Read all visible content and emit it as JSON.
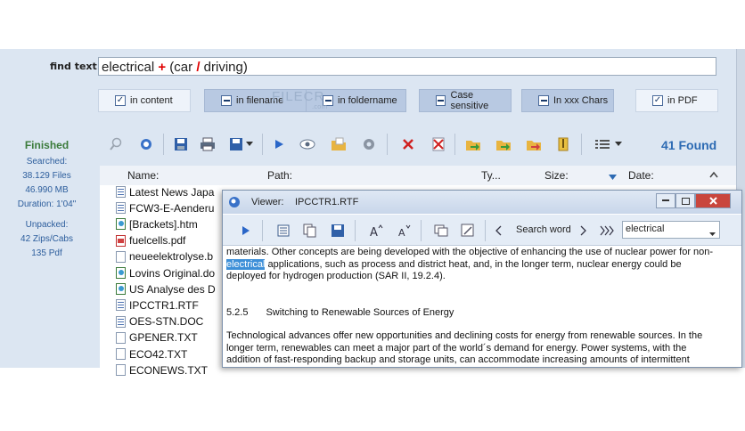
{
  "search": {
    "label": "find text :",
    "term1": "electrical",
    "op_and": "+",
    "paren_open": "(",
    "term2": "car",
    "op_or": "/",
    "term3": "driving",
    "paren_close": ")"
  },
  "options": [
    {
      "label": "in content",
      "checked": true
    },
    {
      "label": "in filename",
      "checked": false
    },
    {
      "label": "in foldername",
      "checked": false
    },
    {
      "label": "Case sensitive",
      "checked": false
    },
    {
      "label": "In xxx Chars",
      "checked": false
    },
    {
      "label": "in PDF",
      "checked": true
    }
  ],
  "watermark": {
    "text": "FILECR",
    "sub": ".com"
  },
  "status": {
    "state": "Finished",
    "searched_label": "Searched:",
    "files": "38.129 Files",
    "size": "46.990 MB",
    "duration": "Duration: 1'04\"",
    "unpacked_label": "Unpacked:",
    "zips": "42 Zips/Cabs",
    "pdf": "135 Pdf"
  },
  "toolbar": {
    "icons": [
      "search-icon",
      "find-icon",
      "save-icon",
      "print-icon",
      "export-icon",
      "dropdown-icon",
      "play-icon",
      "view-icon",
      "open-folder-icon",
      "settings-icon",
      "delete-icon",
      "delete-file-icon",
      "copy-to-icon",
      "move-to-icon",
      "rename-icon",
      "archive-icon",
      "view-mode-icon"
    ],
    "found": "41 Found"
  },
  "columns": {
    "name": "Name:",
    "path": "Path:",
    "type": "Ty...",
    "size": "Size:",
    "date": "Date:"
  },
  "files": [
    {
      "name": "Latest News Japa",
      "kind": "rtf"
    },
    {
      "name": "FCW3-E-Aenderu",
      "kind": "rtf"
    },
    {
      "name": "[Brackets].htm",
      "kind": "htm"
    },
    {
      "name": "fuelcells.pdf",
      "kind": "pdf"
    },
    {
      "name": "neueelektrolyse.b",
      "kind": "doc"
    },
    {
      "name": "Lovins Original.do",
      "kind": "htm"
    },
    {
      "name": "US Analyse des D",
      "kind": "htm"
    },
    {
      "name": "IPCCTR1.RTF",
      "kind": "rtf"
    },
    {
      "name": "OES-STN.DOC",
      "kind": "rtf"
    },
    {
      "name": "GPENER.TXT",
      "kind": "doc"
    },
    {
      "name": "ECO42.TXT",
      "kind": "doc"
    },
    {
      "name": "ECONEWS.TXT",
      "kind": "doc"
    }
  ],
  "viewer": {
    "title_label": "Viewer:",
    "filename": "IPCCTR1.RTF",
    "search_word_label": "Search word",
    "search_word_value": "electrical",
    "lines": {
      "p1a": "materials. Other concepts are being developed with the objective of enhancing the use of nuclear power for non-",
      "p1b_hl": "electrical",
      "p1b": " applications, such as process and district heat, and, in the longer term, nuclear energy could be",
      "p1c": "deployed for hydrogen production (SAR II, 19.2.4).",
      "heading_num": "5.2.5",
      "heading": "Switching to Renewable Sources of Energy",
      "p2a": "Technological advances offer new opportunities and declining costs for energy from renewable sources. In the",
      "p2b": "longer term, renewables can meet a major part of the world´s demand for energy. Power systems, with the",
      "p2c": "addition of fast-responding backup and storage units, can accommodate increasing amounts of intermittent"
    }
  }
}
